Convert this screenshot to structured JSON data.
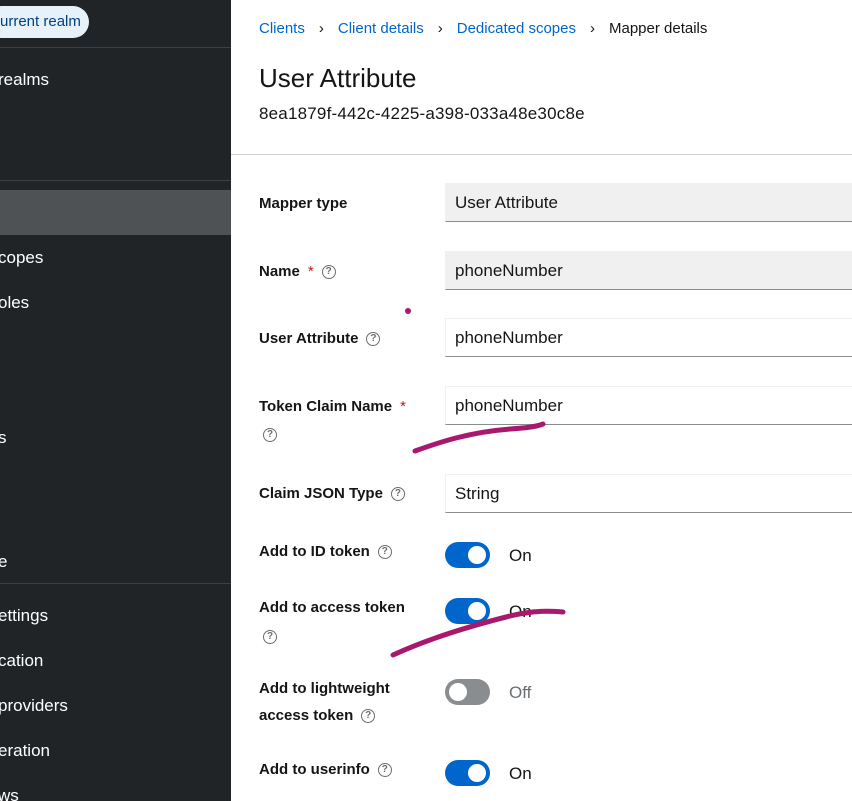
{
  "sidebar": {
    "realm_chip": "urrent realm",
    "items": [
      {
        "label": "realms"
      },
      {
        "label": "copes"
      },
      {
        "label": "oles"
      },
      {
        "label": "s"
      },
      {
        "label": "e"
      },
      {
        "label": "ettings"
      },
      {
        "label": "cation"
      },
      {
        "label": "providers"
      },
      {
        "label": "eration"
      },
      {
        "label": "ws"
      }
    ]
  },
  "breadcrumb": {
    "items": [
      "Clients",
      "Client details",
      "Dedicated scopes"
    ],
    "current": "Mapper details"
  },
  "page": {
    "title": "User Attribute",
    "id": "8ea1879f-442c-4225-a398-033a48e30c8e"
  },
  "form": {
    "mapper_type": {
      "label": "Mapper type",
      "value": "User Attribute"
    },
    "name": {
      "label": "Name",
      "required_mark": "*",
      "value": "phoneNumber"
    },
    "user_attribute": {
      "label": "User Attribute",
      "value": "phoneNumber"
    },
    "token_claim_name": {
      "label": "Token Claim Name",
      "required_mark": "*",
      "value": "phoneNumber"
    },
    "claim_json_type": {
      "label": "Claim JSON Type",
      "value": "String"
    },
    "add_to_id_token": {
      "label": "Add to ID token",
      "state": "On"
    },
    "add_to_access_token": {
      "label": "Add to access token",
      "state": "On"
    },
    "add_to_lightweight": {
      "label_line1": "Add to lightweight",
      "label_line2": "access token",
      "state": "Off"
    },
    "add_to_userinfo": {
      "label": "Add to userinfo",
      "state": "On"
    }
  },
  "help_icon_glyph": "?",
  "breadcrumb_separator": "›",
  "colors": {
    "accent": "#0066cc",
    "sidebar_bg": "#212427",
    "annotation": "#a8196e"
  }
}
